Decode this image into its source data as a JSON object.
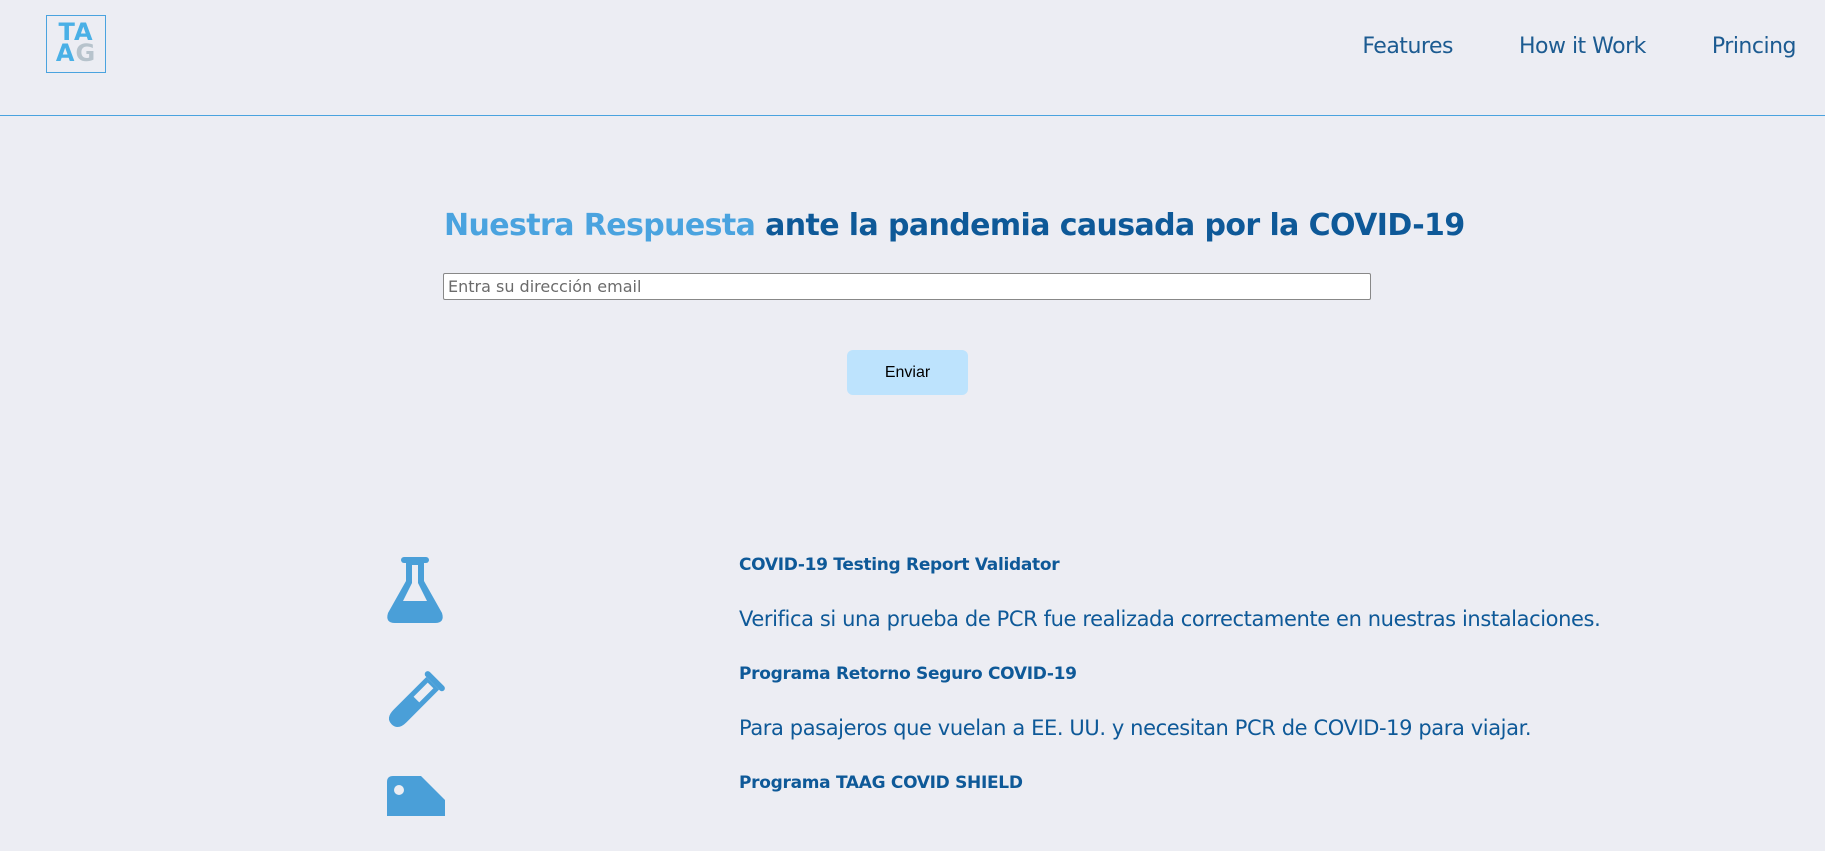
{
  "header": {
    "logo": {
      "line1": "TA",
      "line2_a": "A",
      "line2_g": "G"
    },
    "nav": [
      {
        "label": "Features"
      },
      {
        "label": "How it Work"
      },
      {
        "label": "Princing"
      }
    ]
  },
  "hero": {
    "title_accent": "Nuestra Respuesta",
    "title_rest": " ante la pandemia causada por la COVID-19",
    "email_placeholder": "Entra su dirección email",
    "email_value": "",
    "submit_label": "Enviar"
  },
  "features": [
    {
      "icon": "flask-icon",
      "title": "COVID-19 Testing Report Validator",
      "description": "Verifica si una prueba de PCR fue realizada correctamente en nuestras instalaciones."
    },
    {
      "icon": "test-tube-icon",
      "title": "Programa Retorno Seguro COVID-19",
      "description": "Para pasajeros que vuelan a EE. UU. y necesitan PCR de COVID-19 para viajar."
    },
    {
      "icon": "tag-icon",
      "title": "Programa TAAG COVID SHIELD",
      "description": ""
    }
  ],
  "colors": {
    "background": "#ecedf3",
    "primary": "#0e5998",
    "accent": "#4aa3df",
    "button": "#bde3fd",
    "icon": "#4a9fd8"
  }
}
